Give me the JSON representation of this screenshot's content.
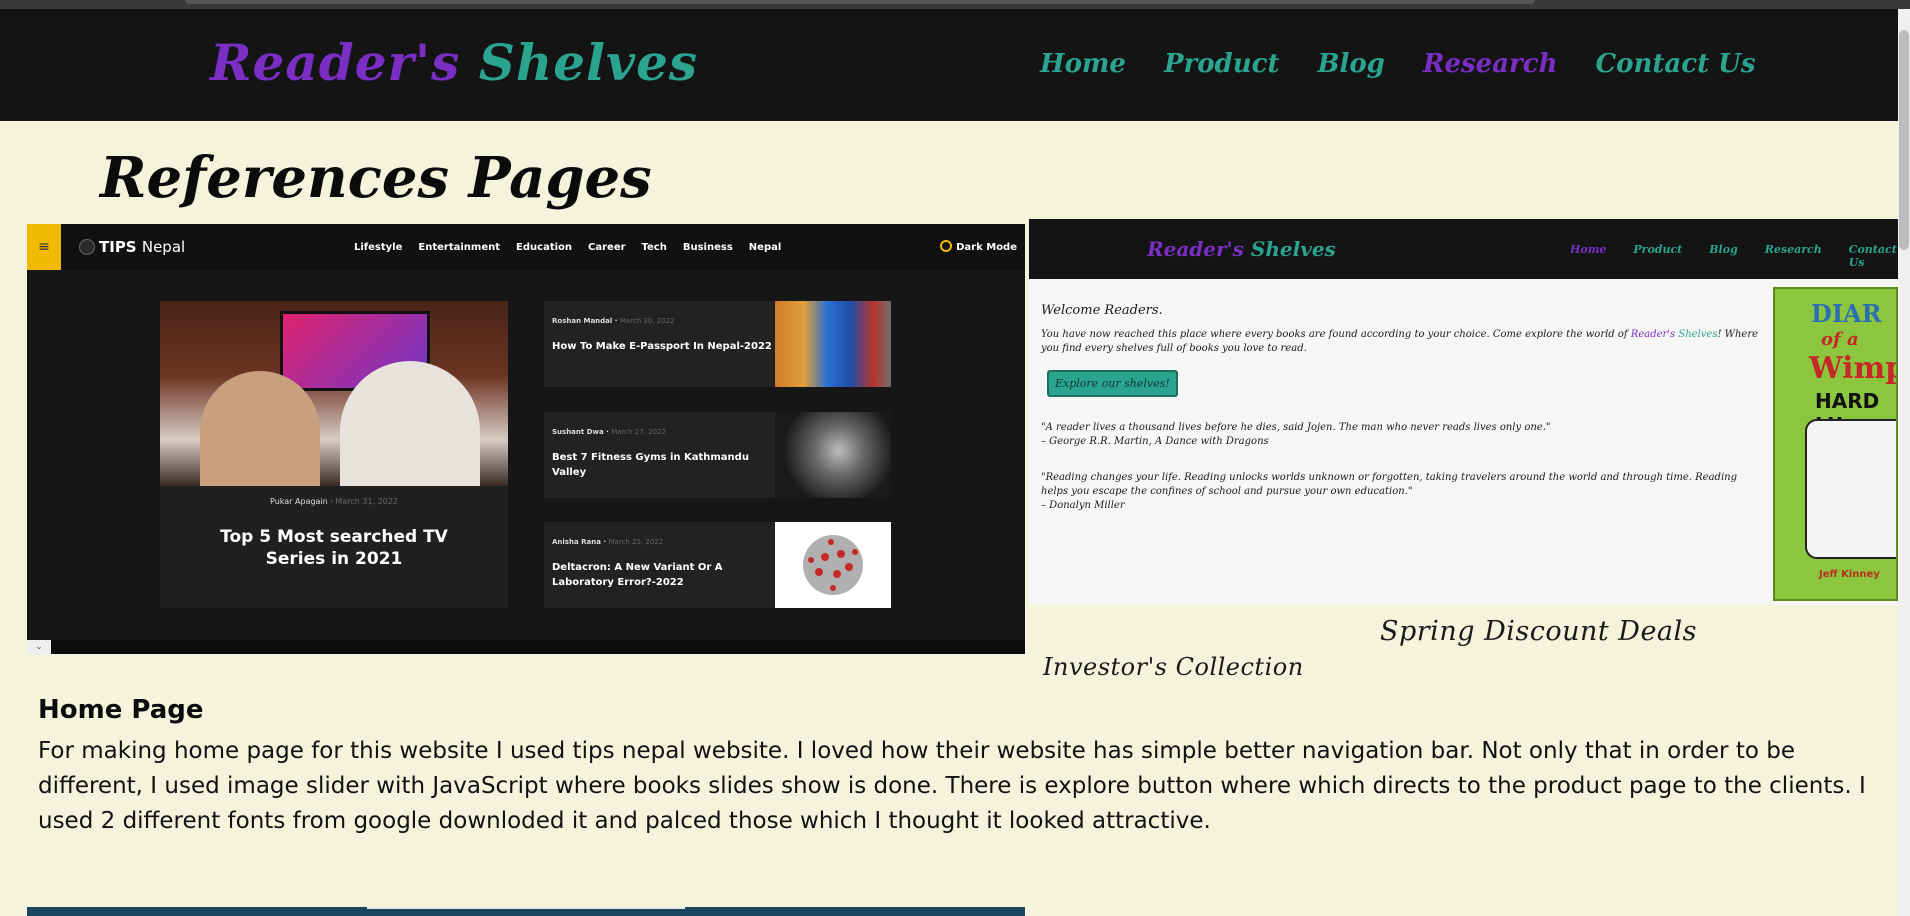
{
  "header": {
    "brand_part1": "Reader's",
    "brand_part2": "Shelves",
    "nav": [
      {
        "label": "Home",
        "color": "#2aa38f"
      },
      {
        "label": "Product",
        "color": "#2aa38f"
      },
      {
        "label": "Blog",
        "color": "#2aa38f"
      },
      {
        "label": "Research",
        "color": "#7a2ec4"
      },
      {
        "label": "Contact Us",
        "color": "#2aa38f"
      }
    ]
  },
  "page": {
    "title": "References Pages"
  },
  "reference_left": {
    "menu_icon": "hamburger-icon",
    "logo_bold": "TIPS",
    "logo_thin": "Nepal",
    "links": [
      "Lifestyle",
      "Entertainment",
      "Education",
      "Career",
      "Tech",
      "Business",
      "Nepal"
    ],
    "dark_mode_label": "Dark Mode",
    "hero": {
      "author": "Pukar Apagain",
      "date": "March 31, 2022",
      "title": "Top 5 Most searched TV Series in 2021"
    },
    "cards": [
      {
        "author": "Roshan Mandal",
        "date": "March 30, 2022",
        "title": "How To Make E-Passport In Nepal-2022"
      },
      {
        "author": "Sushant Dwa",
        "date": "March 27, 2022",
        "title": "Best 7 Fitness Gyms in Kathmandu Valley"
      },
      {
        "author": "Anisha Rana",
        "date": "March 25, 2022",
        "title": "Deltacron: A New Variant Or A Laboratory Error?-2022"
      }
    ]
  },
  "reference_right": {
    "brand_part1": "Reader's",
    "brand_part2": "Shelves",
    "links": [
      "Home",
      "Product",
      "Blog",
      "Research",
      "Contact Us"
    ],
    "welcome": "Welcome Readers.",
    "para_before": "You have now reached this place where every books are found according to your choice. Come explore the world of",
    "para_brand1": "Reader's",
    "para_brand2": "Shelves",
    "para_after": "! Where you find every shelves full of books you love to read.",
    "button": "Explore our shelves!",
    "quote1": "\"A reader lives a thousand lives before he dies, said Jojen. The man who never reads lives only one.\"",
    "quote1_author": "– George R.R. Martin, A Dance with Dragons",
    "quote2": "\"Reading changes your life. Reading unlocks worlds unknown or forgotten, taking travelers around the world and through time. Reading helps you escape the confines of school and pursue your own education.\"",
    "quote2_author": "– Donalyn Miller",
    "book_line1": "DIAR",
    "book_line2": "of a",
    "book_line3": "Wimpy",
    "book_line4": "HARD LU",
    "book_author": "Jeff Kinney"
  },
  "captions": {
    "spring": "Spring Discount Deals",
    "investor": "Investor's Collection"
  },
  "section": {
    "heading": "Home Page",
    "text": "For making home page for this website I used tips nepal website. I loved how their website has simple better navigation bar. Not only that in order to be different, I used image slider with JavaScript where books slides show is done. There is explore button where which directs to the product page to the clients. I used 2 different fonts from google downloded it and palced those which I thought it looked attractive."
  }
}
